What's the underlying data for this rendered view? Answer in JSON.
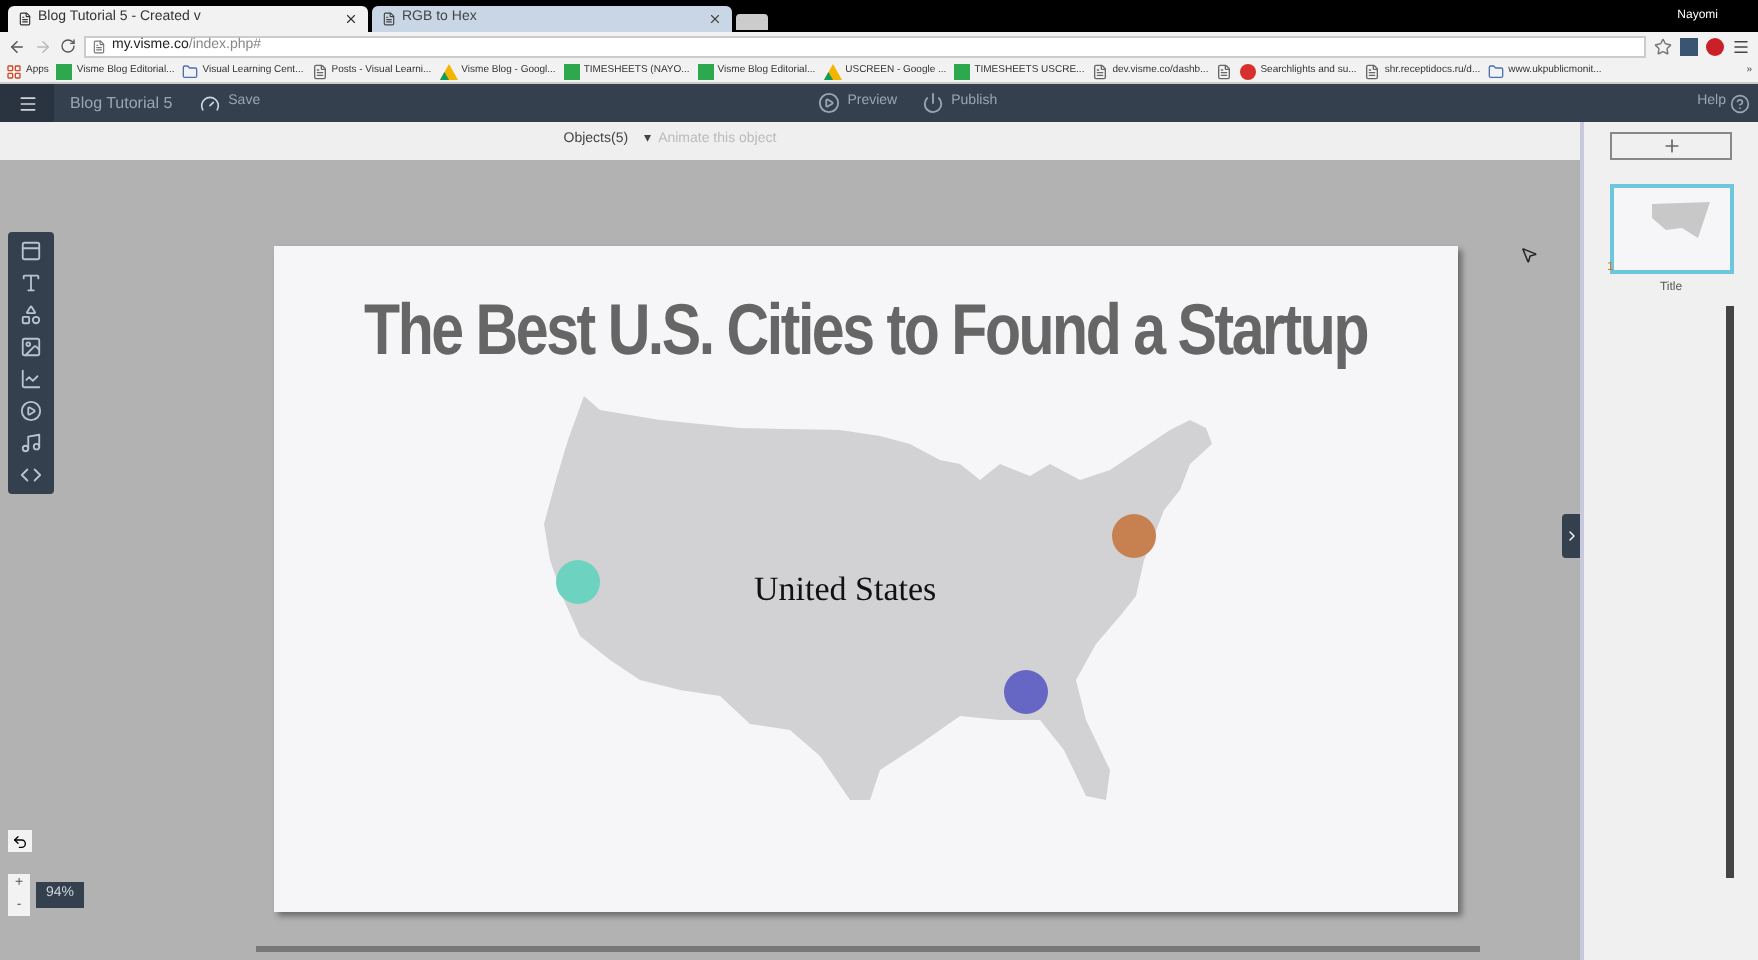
{
  "browser": {
    "tabs": [
      {
        "title": "Blog Tutorial 5 - Created v",
        "selected": true
      },
      {
        "title": "RGB to Hex",
        "selected": false
      }
    ],
    "user": "Nayomi",
    "address": {
      "host": "my.visme.co",
      "path": "/index.php#"
    },
    "bookmarks": [
      {
        "label": "Apps",
        "kind": "apps"
      },
      {
        "label": "Visme Blog Editorial...",
        "kind": "sheet"
      },
      {
        "label": "Visual Learning Cent...",
        "kind": "logo"
      },
      {
        "label": "Posts - Visual Learni...",
        "kind": "page"
      },
      {
        "label": "Visme Blog - Googl...",
        "kind": "drive"
      },
      {
        "label": "TIMESHEETS (NAYO...",
        "kind": "sheet"
      },
      {
        "label": "Visme Blog Editorial...",
        "kind": "sheet"
      },
      {
        "label": "USCREEN - Google ...",
        "kind": "drive"
      },
      {
        "label": "TIMESHEETS USCRE...",
        "kind": "sheet"
      },
      {
        "label": "dev.visme.co/dashb...",
        "kind": "page"
      },
      {
        "kind": "page"
      },
      {
        "label": "Searchlights and su...",
        "kind": "red"
      },
      {
        "label": "shr.receptidocs.ru/d...",
        "kind": "page"
      },
      {
        "label": "www.ukpublicmonit...",
        "kind": "logo"
      }
    ],
    "more": "»"
  },
  "app_bar": {
    "document": "Blog Tutorial 5",
    "save": "Save",
    "preview": "Preview",
    "publish": "Publish",
    "help": "Help"
  },
  "object_bar": {
    "objects": "Objects(5)",
    "caret": "▾",
    "animate": "Animate this object",
    "animate_disabled": true
  },
  "slide": {
    "title": "The Best U.S. Cities to Found a Startup",
    "map_label": "United States",
    "markers": [
      {
        "color": "#6dd3c0"
      },
      {
        "color": "#c7804f"
      },
      {
        "color": "#6666c4"
      }
    ]
  },
  "zoom": {
    "plus": "+",
    "minus": "-",
    "value": "94%"
  },
  "slides_panel": {
    "slides": [
      {
        "number": "1",
        "title": "Title",
        "selected": true
      }
    ]
  }
}
